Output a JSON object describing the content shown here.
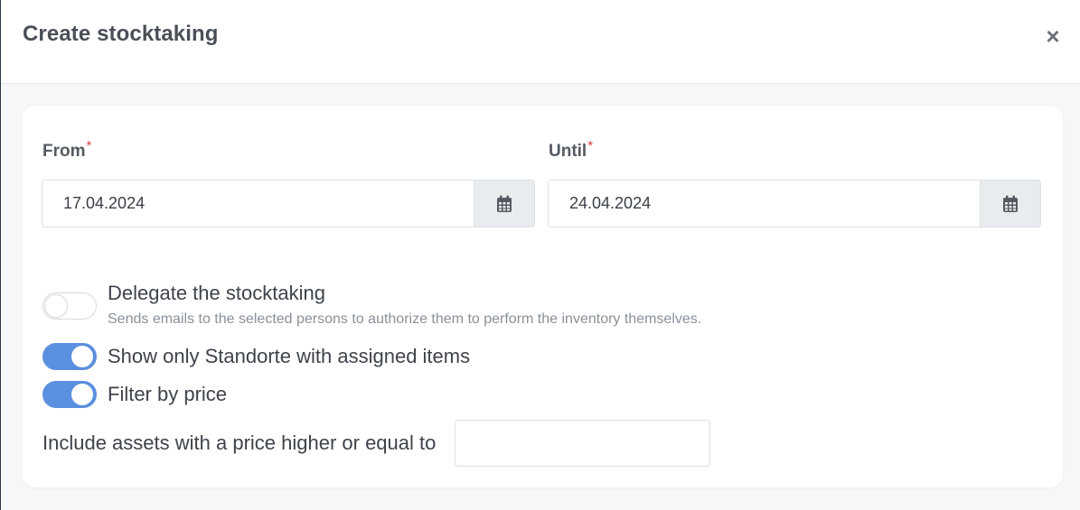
{
  "dialog": {
    "title": "Create stocktaking",
    "close_symbol": "×"
  },
  "from": {
    "label": "From",
    "required_mark": "*",
    "value": "17.04.2024",
    "calendar_icon": "calendar-icon"
  },
  "until": {
    "label": "Until",
    "required_mark": "*",
    "value": "24.04.2024",
    "calendar_icon": "calendar-icon"
  },
  "options": {
    "delegate": {
      "label": "Delegate the stocktaking",
      "description": "Sends emails to the selected persons to authorize them to perform the inventory themselves.",
      "enabled": false
    },
    "assigned_only": {
      "label": "Show only Standorte with assigned items",
      "enabled": true
    },
    "filter_price": {
      "label": "Filter by price",
      "enabled": true
    }
  },
  "price": {
    "label": "Include assets with a price higher or equal to",
    "value": ""
  },
  "colors": {
    "accent": "#5b8fdf",
    "required": "#e03c3c",
    "addon_bg": "#e9ecef"
  }
}
